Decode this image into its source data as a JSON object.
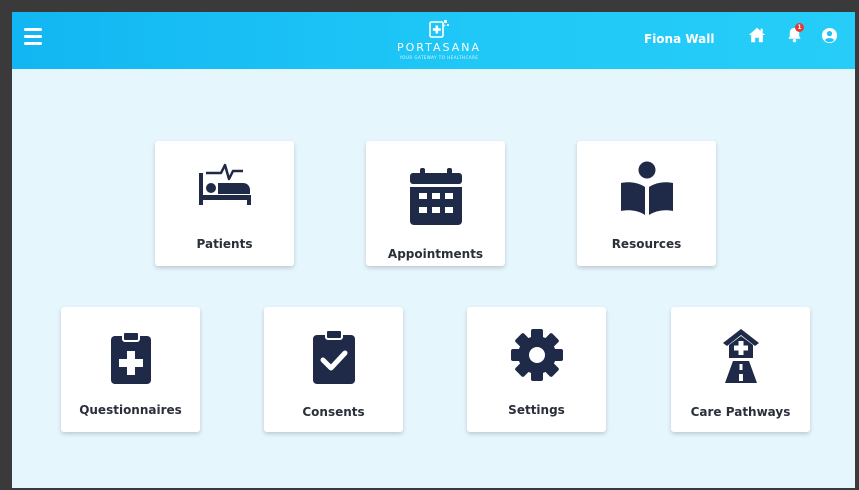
{
  "header": {
    "app_name": "PORTASANA",
    "tagline": "YOUR GATEWAY TO HEALTHCARE",
    "user_name": "Fiona Wall",
    "notification_count": "1",
    "colors": {
      "header_start": "#12b6f2",
      "header_end": "#27cdf8",
      "icon_dark": "#1e2a47",
      "badge": "#e53935"
    }
  },
  "tiles": [
    {
      "label": "Patients",
      "icon": "patient-bed-icon"
    },
    {
      "label": "Appointments",
      "icon": "calendar-icon"
    },
    {
      "label": "Resources",
      "icon": "book-reader-icon"
    },
    {
      "label": "Questionnaires",
      "icon": "medical-clipboard-icon"
    },
    {
      "label": "Consents",
      "icon": "clipboard-check-icon"
    },
    {
      "label": "Settings",
      "icon": "gear-icon"
    },
    {
      "label": "Care Pathways",
      "icon": "hospital-road-icon"
    }
  ]
}
